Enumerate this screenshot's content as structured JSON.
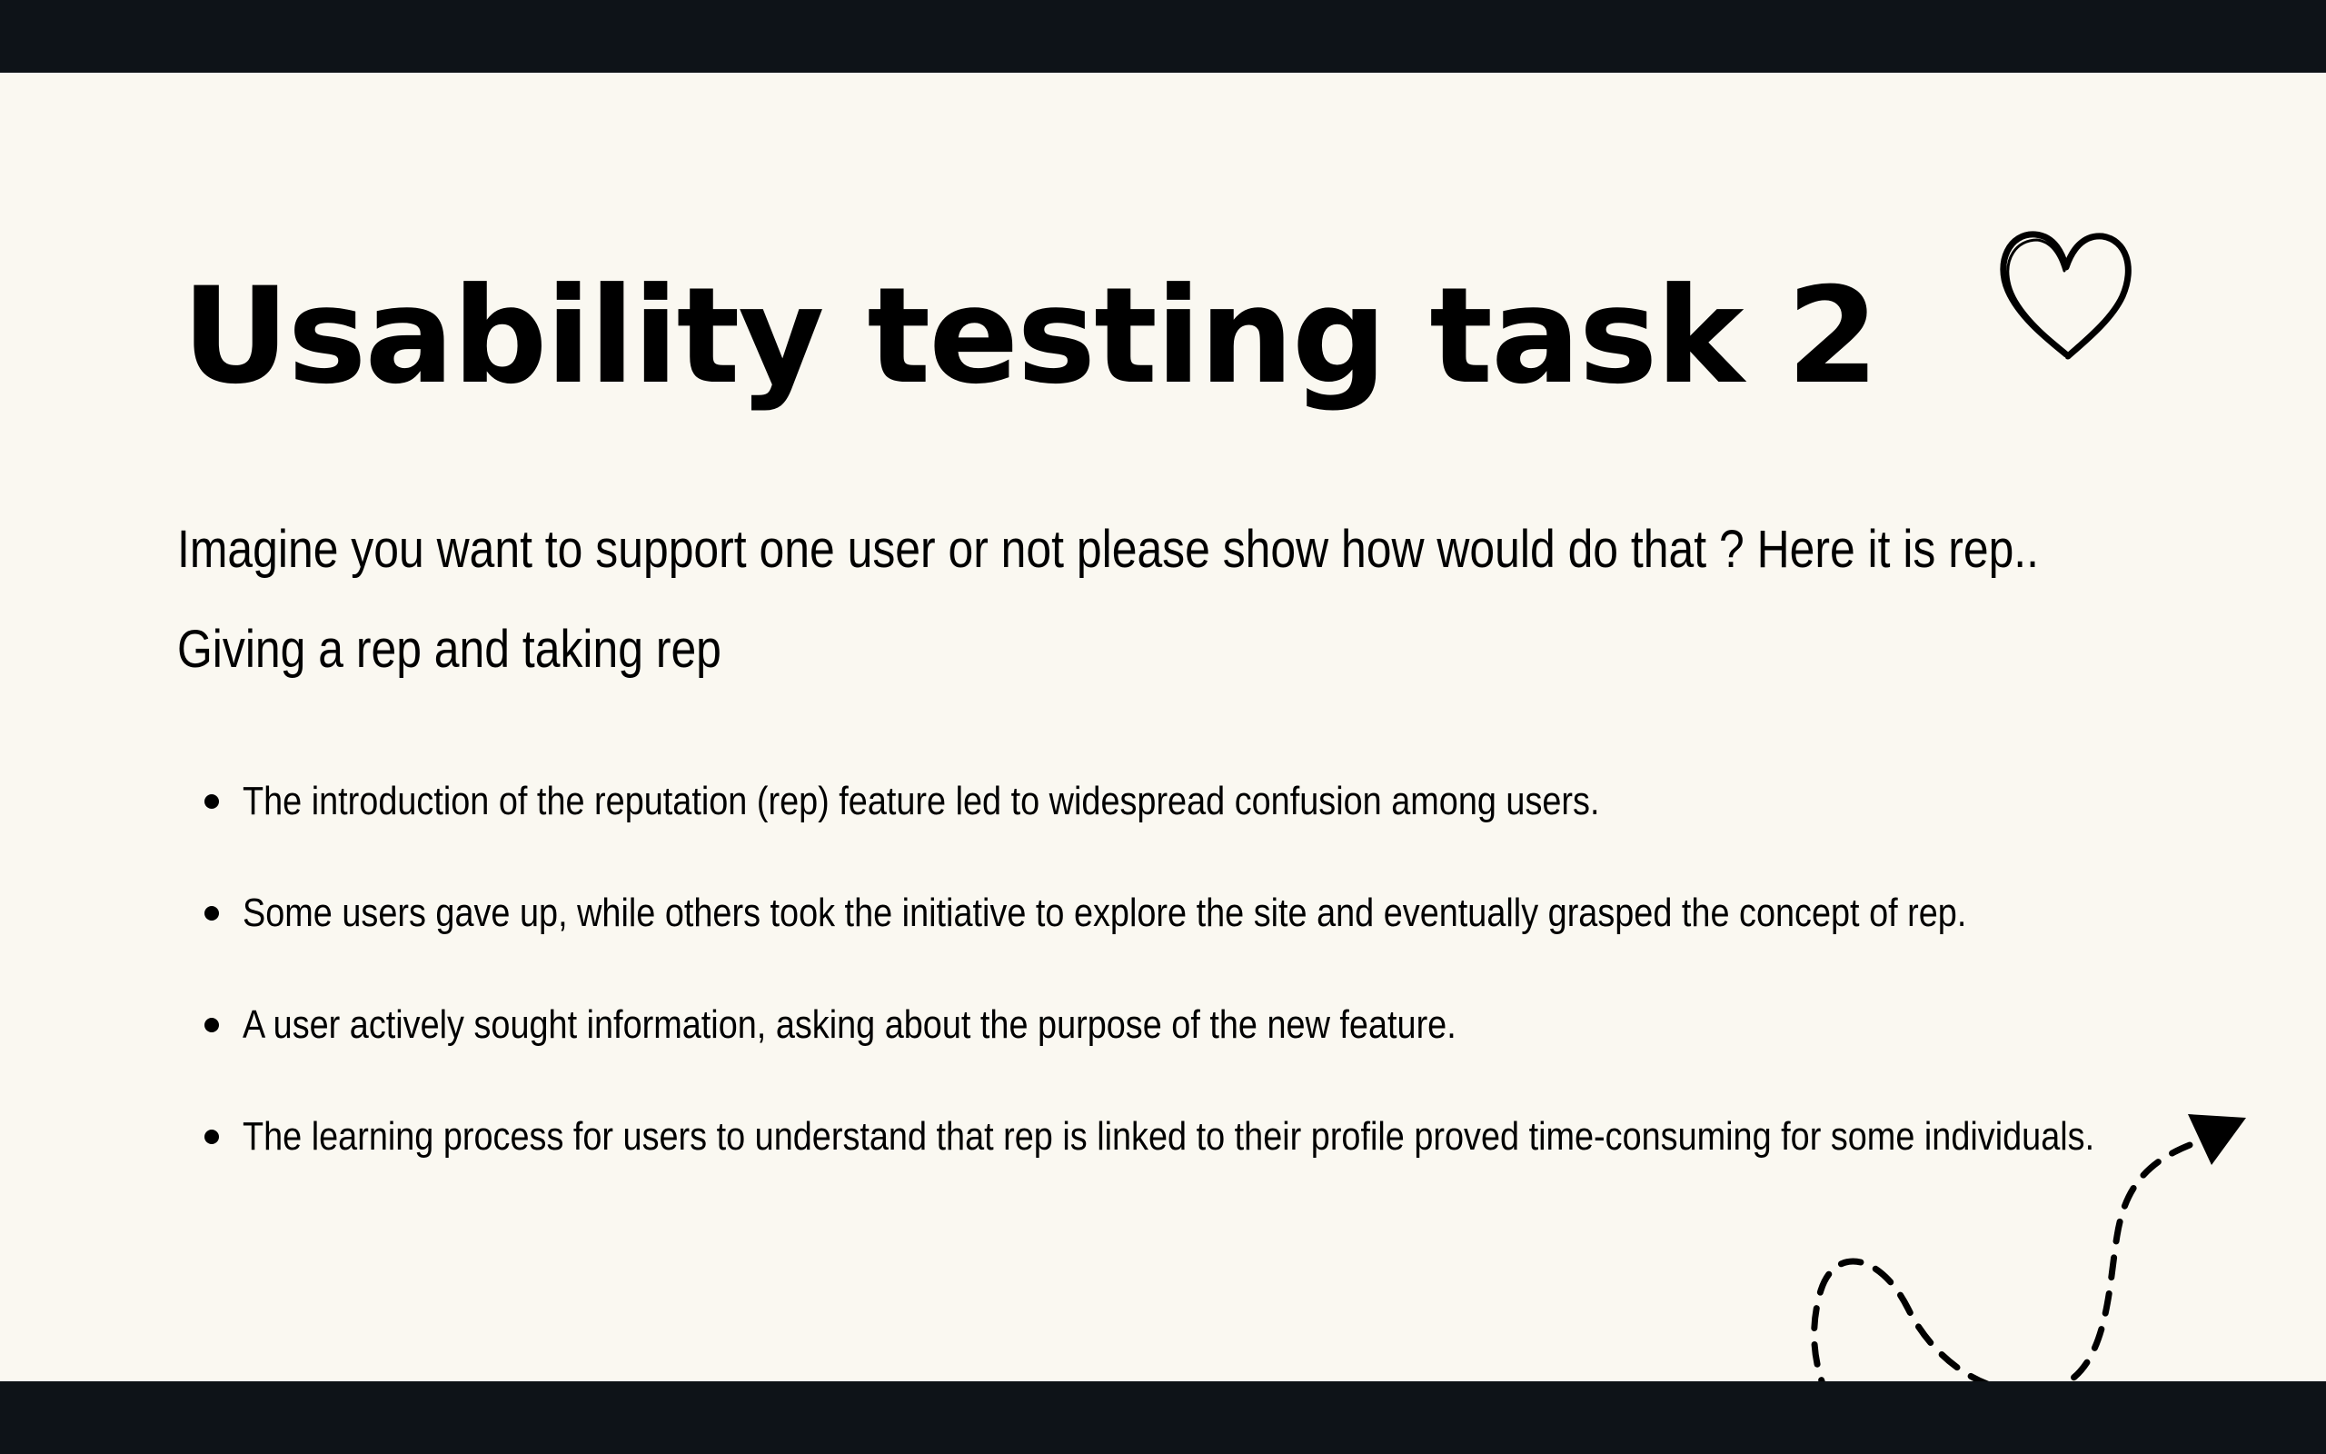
{
  "slide": {
    "title": "Usability testing task 2",
    "intro_lines": [
      "Imagine you want to support one user or not please show how would do that ? Here it is rep..",
      "Giving a rep and taking rep"
    ],
    "bullets": [
      "The introduction of the reputation (rep) feature led to widespread confusion among users.",
      "Some users gave up, while others took the initiative to explore the site and eventually grasped the concept of rep.",
      "A user actively sought information, asking about the purpose of the new feature.",
      "The learning process for users to understand that rep is linked to their profile proved time-consuming for some individuals."
    ],
    "decorations": [
      "heart-icon",
      "dashed-arrow-icon"
    ]
  },
  "colors": {
    "frame": "#0e1318",
    "slide_background": "#faf8f1",
    "text": "#000000"
  }
}
